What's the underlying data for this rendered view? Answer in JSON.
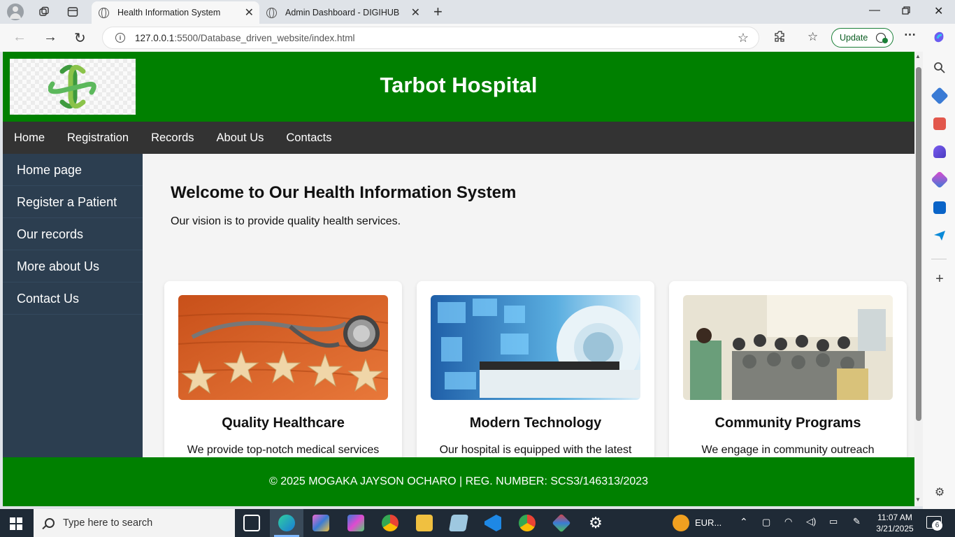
{
  "browser": {
    "tabs": [
      {
        "title": "Health Information System",
        "active": true
      },
      {
        "title": "Admin Dashboard - DIGIHUB",
        "active": false
      }
    ],
    "url_host": "127.0.0.1",
    "url_rest": ":5500/Database_driven_website/index.html",
    "update_label": "Update"
  },
  "site": {
    "title": "Tarbot Hospital",
    "brand_color": "#008000",
    "topnav": [
      "Home",
      "Registration",
      "Records",
      "About Us",
      "Contacts"
    ],
    "sidenav": [
      "Home page",
      "Register a Patient",
      "Our records",
      "More about Us",
      "Contact Us"
    ],
    "welcome_heading": "Welcome to Our Health Information System",
    "vision": "Our vision is to provide quality health services.",
    "cards": [
      {
        "title": "Quality Healthcare",
        "text": "We provide top-notch medical services"
      },
      {
        "title": "Modern Technology",
        "text": "Our hospital is equipped with the latest"
      },
      {
        "title": "Community Programs",
        "text": "We engage in community outreach"
      }
    ],
    "footer": "© 2025 MOGAKA JAYSON OCHARO | REG. NUMBER: SCS3/146313/2023"
  },
  "taskbar": {
    "search_placeholder": "Type here to search",
    "tray_label": "EUR...",
    "time": "11:07 AM",
    "date": "3/21/2025",
    "notification_count": "6"
  }
}
